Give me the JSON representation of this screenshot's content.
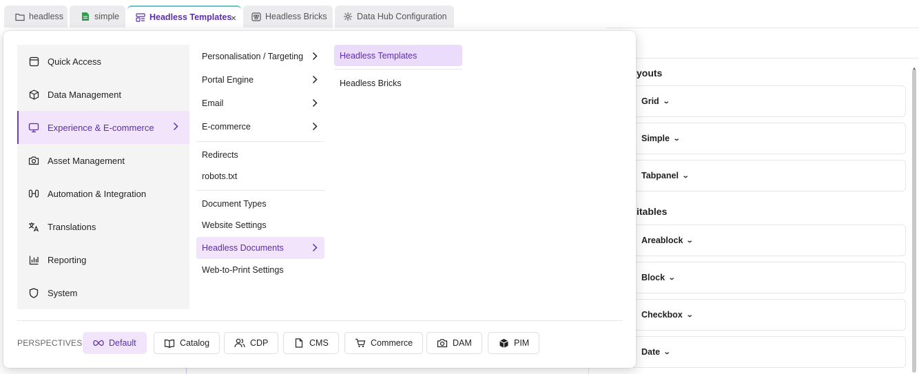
{
  "tabs": [
    {
      "label": "headless",
      "icon": "folder-icon"
    },
    {
      "label": "simple",
      "icon": "document-icon"
    },
    {
      "label": "Headless Templates",
      "icon": "template-icon",
      "close": "×"
    },
    {
      "label": "Headless Bricks",
      "icon": "bricks-icon"
    },
    {
      "label": "Data Hub Configuration",
      "icon": "datahub-icon"
    }
  ],
  "background": {
    "sections": [
      "youts",
      "itables"
    ],
    "layout_items": [
      "Grid",
      "Simple",
      "Tabpanel"
    ],
    "editable_items": [
      "Areablock",
      "Block",
      "Checkbox",
      "Date"
    ]
  },
  "menu": {
    "main": [
      {
        "label": "Quick Access",
        "icon": "quick-access-icon"
      },
      {
        "label": "Data Management",
        "icon": "cube-icon"
      },
      {
        "label": "Experience & E-commerce",
        "icon": "monitor-icon"
      },
      {
        "label": "Asset Management",
        "icon": "camera-icon"
      },
      {
        "label": "Automation & Integration",
        "icon": "automation-icon"
      },
      {
        "label": "Translations",
        "icon": "translate-icon"
      },
      {
        "label": "Reporting",
        "icon": "chart-icon"
      },
      {
        "label": "System",
        "icon": "shield-icon"
      }
    ],
    "sub": [
      {
        "label": "Personalisation / Targeting"
      },
      {
        "label": "Portal Engine"
      },
      {
        "label": "Email"
      },
      {
        "label": "E-commerce"
      },
      {
        "label": "Redirects"
      },
      {
        "label": "robots.txt"
      },
      {
        "label": "Document Types"
      },
      {
        "label": "Website Settings"
      },
      {
        "label": "Headless Documents"
      },
      {
        "label": "Web-to-Print Settings"
      }
    ],
    "third": [
      {
        "label": "Headless Templates"
      },
      {
        "label": "Headless Bricks"
      }
    ]
  },
  "perspectives": {
    "label": "PERSPECTIVES",
    "items": [
      {
        "label": "Default",
        "icon": "infinity-icon"
      },
      {
        "label": "Catalog",
        "icon": "book-icon"
      },
      {
        "label": "CDP",
        "icon": "users-icon"
      },
      {
        "label": "CMS",
        "icon": "file-icon"
      },
      {
        "label": "Commerce",
        "icon": "cart-icon"
      },
      {
        "label": "DAM",
        "icon": "camera-icon"
      },
      {
        "label": "PIM",
        "icon": "box-icon"
      }
    ]
  },
  "colors": {
    "accent": "#5a2ea8",
    "active_bg": "#f1e4fb",
    "tab_indicator": "#5fc3c8"
  }
}
